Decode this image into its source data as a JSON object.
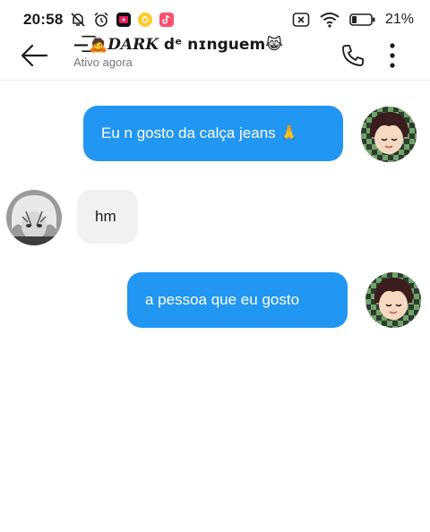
{
  "status_bar": {
    "time": "20:58",
    "battery": "21%",
    "icons": [
      "muted-bell-icon",
      "alarm-icon",
      "video-app-icon",
      "yellow-app-icon",
      "tiktok-icon",
      "sim-off-icon",
      "wifi-icon",
      "battery-icon"
    ]
  },
  "header": {
    "name_prefix": "—͟͟͞͞🙇",
    "name_dark": "DARK",
    "name_suffix": " dᵉ nɪnguem😹",
    "status": "Ativo agora",
    "icons": [
      "back-arrow-icon",
      "phone-icon",
      "more-vertical-icon"
    ]
  },
  "messages": [
    {
      "side": "out",
      "text": "Eu n gosto da calça jeans 🙏"
    },
    {
      "side": "in",
      "text": "hm"
    },
    {
      "side": "out",
      "text": "a pessoa que eu gosto"
    }
  ],
  "colors": {
    "outgoing_bubble": "#2196f3",
    "incoming_bubble": "#f1f1f3"
  }
}
